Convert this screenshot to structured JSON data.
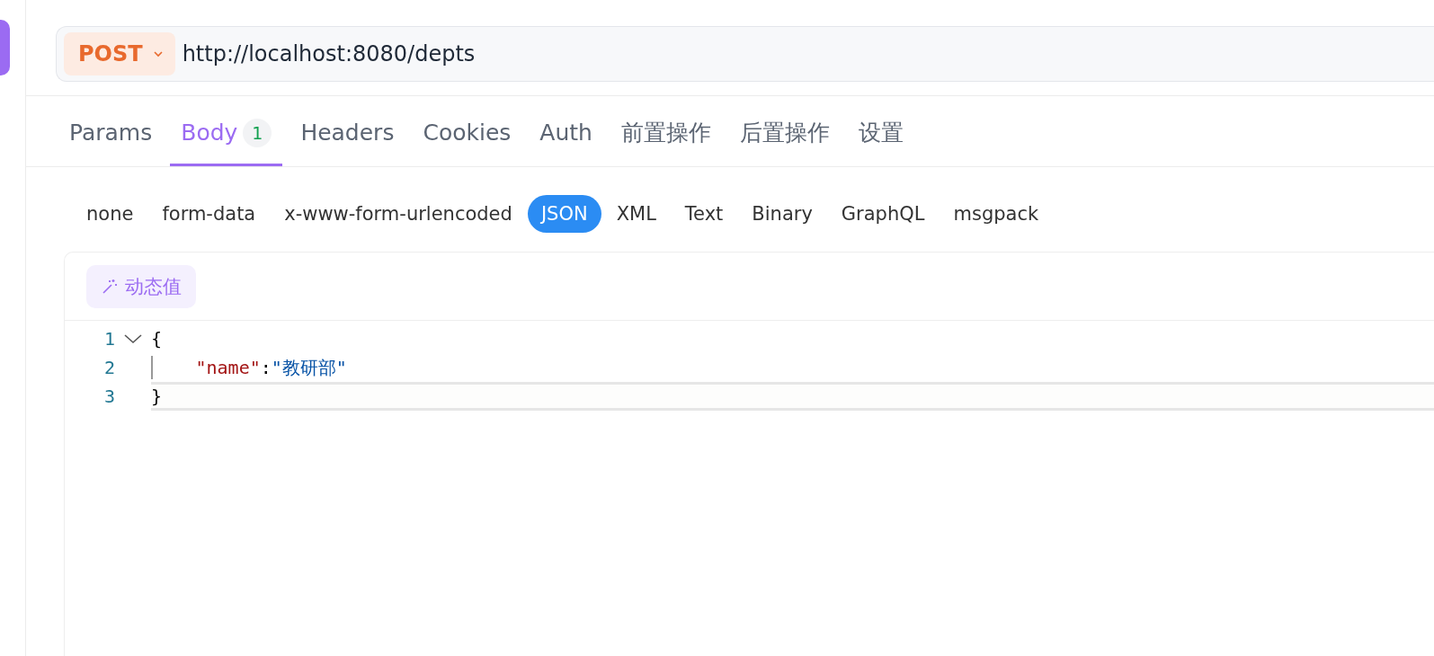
{
  "request": {
    "method": "POST",
    "url": "http://localhost:8080/depts"
  },
  "tabs": [
    {
      "label": "Params",
      "selected": false
    },
    {
      "label": "Body",
      "badge": "1",
      "selected": true
    },
    {
      "label": "Headers",
      "selected": false
    },
    {
      "label": "Cookies",
      "selected": false
    },
    {
      "label": "Auth",
      "selected": false
    },
    {
      "label": "前置操作",
      "selected": false
    },
    {
      "label": "后置操作",
      "selected": false
    },
    {
      "label": "设置",
      "selected": false
    }
  ],
  "body_types": [
    {
      "label": "none",
      "selected": false
    },
    {
      "label": "form-data",
      "selected": false
    },
    {
      "label": "x-www-form-urlencoded",
      "selected": false
    },
    {
      "label": "JSON",
      "selected": true
    },
    {
      "label": "XML",
      "selected": false
    },
    {
      "label": "Text",
      "selected": false
    },
    {
      "label": "Binary",
      "selected": false
    },
    {
      "label": "GraphQL",
      "selected": false
    },
    {
      "label": "msgpack",
      "selected": false
    }
  ],
  "dynamic_value_button": "动态值",
  "editor": {
    "lines": [
      {
        "number": "1",
        "foldable": true,
        "indented": false,
        "active": false,
        "tokens": [
          {
            "kind": "punct",
            "text": "{"
          }
        ]
      },
      {
        "number": "2",
        "foldable": false,
        "indented": true,
        "active": false,
        "tokens": [
          {
            "kind": "key",
            "text": "\"name\""
          },
          {
            "kind": "punct",
            "text": ":"
          },
          {
            "kind": "string",
            "text": "\"教研部\""
          }
        ]
      },
      {
        "number": "3",
        "foldable": false,
        "indented": false,
        "active": true,
        "tokens": [
          {
            "kind": "punct",
            "text": "}"
          }
        ]
      }
    ]
  }
}
